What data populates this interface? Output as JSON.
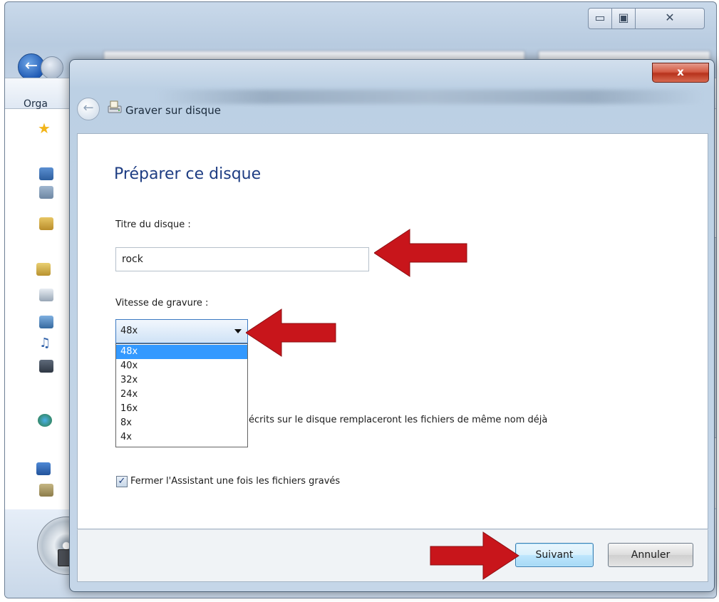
{
  "background_window": {
    "toolbar_label_partial": "Orga",
    "minimize_label": "▭",
    "maximize_label": "▣",
    "close_label": "✕"
  },
  "dialog": {
    "close_label": "x",
    "back_icon": "back-arrow-icon",
    "title_icon": "burn-disc-icon",
    "title": "Graver sur disque",
    "heading": "Préparer ce disque",
    "disc_title_label": "Titre du disque :",
    "disc_title_value": "rock",
    "speed_label": "Vitesse de gravure :",
    "speed_selected": "48x",
    "speed_options": [
      "48x",
      "40x",
      "32x",
      "24x",
      "16x",
      "8x",
      "4x"
    ],
    "partial_text_line1": "écrits sur le disque remplaceront les fichiers de même nom déjà",
    "partial_text_line2": "",
    "close_wizard_checked": true,
    "close_wizard_check_glyph": "✓",
    "close_wizard_label": "Fermer l'Assistant une fois les fichiers gravés",
    "next_label": "Suivant",
    "cancel_label": "Annuler"
  },
  "colors": {
    "heading": "#1e3d83",
    "selected_option": "#3399ff",
    "arrow": "#c8151b"
  }
}
